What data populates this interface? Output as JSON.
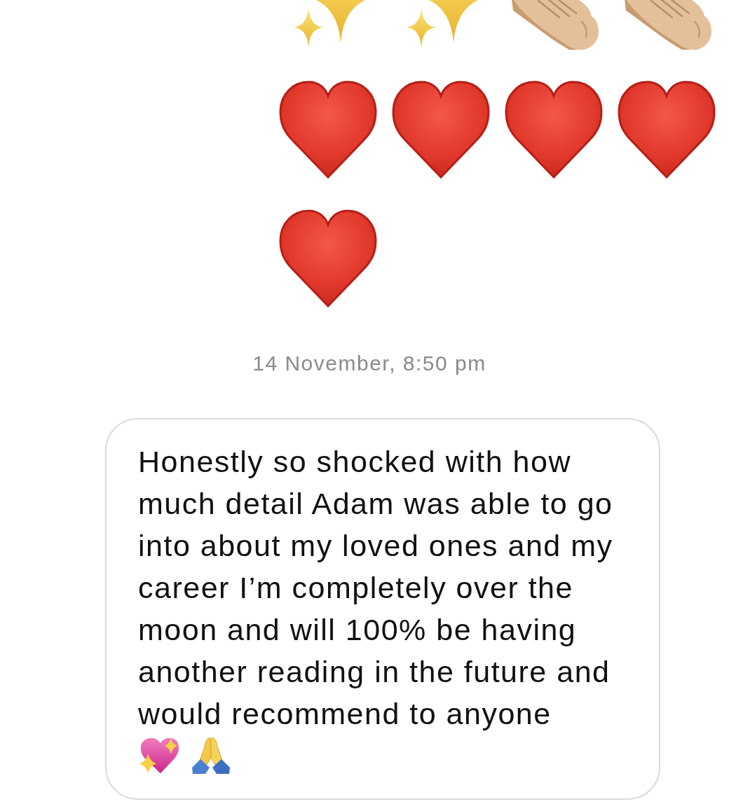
{
  "emoji_message": {
    "emoji": [
      {
        "kind": "sparkles"
      },
      {
        "kind": "sparkles"
      },
      {
        "kind": "clapping-hands"
      },
      {
        "kind": "clapping-hands"
      },
      {
        "kind": "heart"
      },
      {
        "kind": "heart"
      },
      {
        "kind": "heart"
      },
      {
        "kind": "heart"
      },
      {
        "kind": "heart"
      }
    ]
  },
  "timestamp": "14 November, 8:50 pm",
  "message": {
    "text": "Honestly so shocked with how much detail Adam was able to go into about my loved ones and my career I’m completely over the moon and will 100% be having another reading in the future and would recommend to anyone",
    "trailing_emoji": [
      {
        "kind": "sparkling-heart"
      },
      {
        "kind": "folded-hands"
      }
    ]
  }
}
